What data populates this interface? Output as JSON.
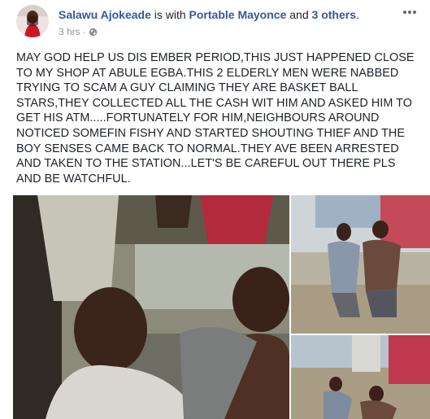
{
  "post": {
    "author": "Salawu Ajokeade",
    "with_text": " is with ",
    "tagged_1": "Portable Mayonce",
    "and_text": " and ",
    "tagged_others": "3 others",
    "period": ".",
    "timestamp": "3 hrs",
    "separator": "·",
    "privacy_icon": "globe-icon",
    "more_icon": "more-options-icon",
    "text": "MAY GOD HELP US DIS EMBER PERIOD,THIS JUST HAPPENED CLOSE TO MY SHOP AT ABULE EGBA.THIS 2 ELDERLY MEN WERE NABBED TRYING TO SCAM A GUY CLAIMING THEY ARE BASKET BALL STARS,THEY COLLECTED ALL THE CASH WIT HIM AND ASKED HIM TO GET HIS ATM.....FORTUNATELY FOR HIM,NEIGHBOURS AROUND NOTICED SOMEFIN FISHY AND STARTED SHOUTING THIEF AND THE BOY SENSES CAME BACK TO NORMAL.THEY AVE BEEN ARRESTED AND TAKEN TO THE STATION...LET'S BE CAREFUL OUT THERE PLS AND BE WATCHFUL."
  },
  "colors": {
    "link": "#365899",
    "text": "#1d2129",
    "meta": "#90949c"
  }
}
